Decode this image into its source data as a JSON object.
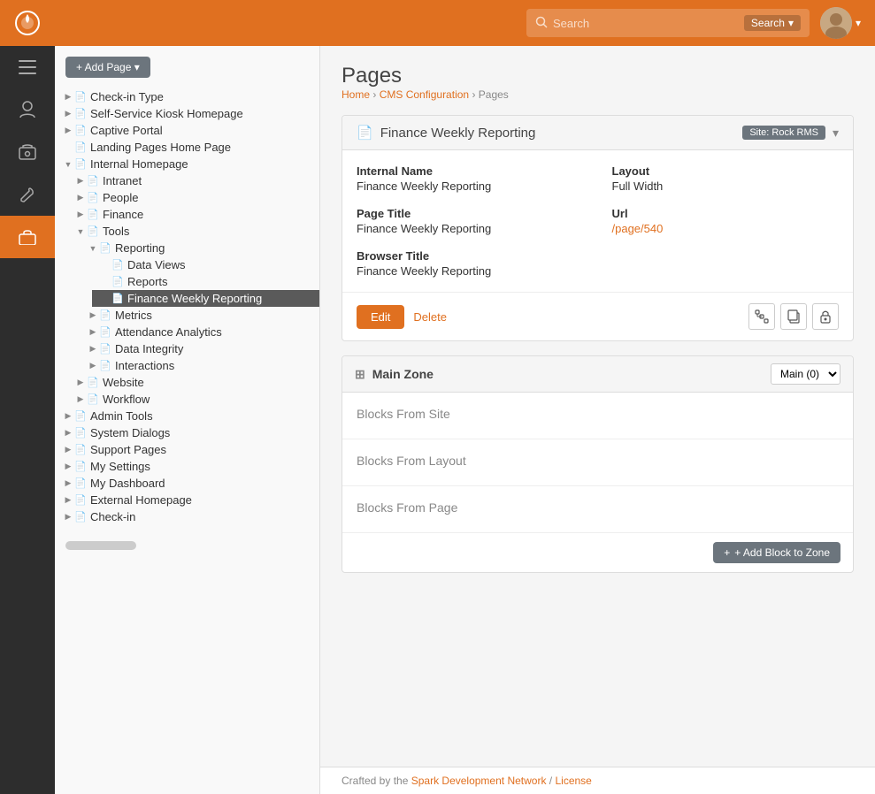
{
  "app": {
    "logo_icon": "◎",
    "title": "Pages"
  },
  "topbar": {
    "search_placeholder": "Search",
    "search_button": "Search",
    "search_caret": "▾"
  },
  "breadcrumb": {
    "home": "Home",
    "cms": "CMS Configuration",
    "current": "Pages"
  },
  "sidebar": {
    "add_button": "+ Add Page ▾",
    "tree": [
      {
        "id": "check-in-type",
        "label": "Check-in Type",
        "level": 0,
        "expanded": false
      },
      {
        "id": "self-service-kiosk",
        "label": "Self-Service Kiosk Homepage",
        "level": 0,
        "expanded": false
      },
      {
        "id": "captive-portal",
        "label": "Captive Portal",
        "level": 0,
        "expanded": false
      },
      {
        "id": "landing-pages",
        "label": "Landing Pages Home Page",
        "level": 0,
        "expanded": false
      },
      {
        "id": "internal-homepage",
        "label": "Internal Homepage",
        "level": 0,
        "expanded": true
      },
      {
        "id": "intranet",
        "label": "Intranet",
        "level": 1,
        "expanded": false
      },
      {
        "id": "people",
        "label": "People",
        "level": 1,
        "expanded": false
      },
      {
        "id": "finance",
        "label": "Finance",
        "level": 1,
        "expanded": false
      },
      {
        "id": "tools",
        "label": "Tools",
        "level": 1,
        "expanded": true
      },
      {
        "id": "reporting",
        "label": "Reporting",
        "level": 2,
        "expanded": true
      },
      {
        "id": "data-views",
        "label": "Data Views",
        "level": 3,
        "expanded": false
      },
      {
        "id": "reports",
        "label": "Reports",
        "level": 3,
        "expanded": false
      },
      {
        "id": "finance-weekly",
        "label": "Finance Weekly Reporting",
        "level": 3,
        "expanded": false,
        "active": true
      },
      {
        "id": "metrics",
        "label": "Metrics",
        "level": 2,
        "expanded": false
      },
      {
        "id": "attendance-analytics",
        "label": "Attendance Analytics",
        "level": 2,
        "expanded": false
      },
      {
        "id": "data-integrity",
        "label": "Data Integrity",
        "level": 2,
        "expanded": false
      },
      {
        "id": "interactions",
        "label": "Interactions",
        "level": 2,
        "expanded": false
      },
      {
        "id": "website",
        "label": "Website",
        "level": 1,
        "expanded": false
      },
      {
        "id": "workflow",
        "label": "Workflow",
        "level": 1,
        "expanded": false
      },
      {
        "id": "admin-tools",
        "label": "Admin Tools",
        "level": 0,
        "expanded": false
      },
      {
        "id": "system-dialogs",
        "label": "System Dialogs",
        "level": 0,
        "expanded": false
      },
      {
        "id": "support-pages",
        "label": "Support Pages",
        "level": 0,
        "expanded": false
      },
      {
        "id": "my-settings",
        "label": "My Settings",
        "level": 0,
        "expanded": false
      },
      {
        "id": "my-dashboard",
        "label": "My Dashboard",
        "level": 0,
        "expanded": false
      },
      {
        "id": "external-homepage",
        "label": "External Homepage",
        "level": 0,
        "expanded": false
      },
      {
        "id": "check-in",
        "label": "Check-in",
        "level": 0,
        "expanded": false
      }
    ]
  },
  "detail": {
    "title": "Finance Weekly Reporting",
    "site_badge": "Site: Rock RMS",
    "internal_name_label": "Internal Name",
    "internal_name_value": "Finance Weekly Reporting",
    "layout_label": "Layout",
    "layout_value": "Full Width",
    "page_title_label": "Page Title",
    "page_title_value": "Finance Weekly Reporting",
    "url_label": "Url",
    "url_value": "/page/540",
    "browser_title_label": "Browser Title",
    "browser_title_value": "Finance Weekly Reporting",
    "edit_btn": "Edit",
    "delete_btn": "Delete"
  },
  "zone": {
    "title": "Main Zone",
    "select_option": "Main (0)",
    "blocks_from_site": "Blocks From Site",
    "blocks_from_layout": "Blocks From Layout",
    "blocks_from_page": "Blocks From Page",
    "add_block_btn": "+ Add Block to Zone"
  },
  "footer": {
    "text": "Crafted by the",
    "link1": "Spark Development Network",
    "separator": "/",
    "link2": "License"
  },
  "nav_icons": [
    {
      "id": "nav-home",
      "icon": "≡",
      "active": false
    },
    {
      "id": "nav-person",
      "icon": "👤",
      "active": false
    },
    {
      "id": "nav-finance",
      "icon": "$",
      "active": false
    },
    {
      "id": "nav-wrench",
      "icon": "🔧",
      "active": false
    },
    {
      "id": "nav-briefcase",
      "icon": "💼",
      "active": true
    }
  ]
}
